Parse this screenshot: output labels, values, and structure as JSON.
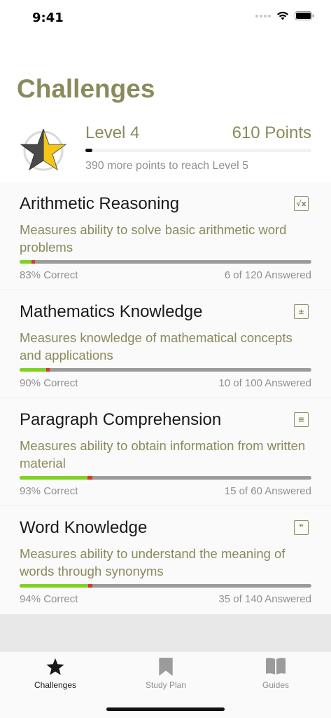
{
  "status": {
    "time": "9:41"
  },
  "page": {
    "title": "Challenges"
  },
  "level": {
    "label": "Level 4",
    "points": "610 Points",
    "remaining": "390 more points to reach Level 5",
    "progress_fraction": 0.03
  },
  "challenges": [
    {
      "title": "Arithmetic Reasoning",
      "icon": "square-root-icon",
      "icon_glyph": "√x",
      "description": "Measures ability to solve basic arithmetic word problems",
      "correct_text": "83% Correct",
      "answered_text": "6 of 120 Answered",
      "answered_fraction": 0.05,
      "correct_ratio": 0.83
    },
    {
      "title": "Mathematics Knowledge",
      "icon": "calculator-icon",
      "icon_glyph": "±",
      "description": "Measures knowledge of mathematical concepts and applications",
      "correct_text": "90% Correct",
      "answered_text": "10 of 100 Answered",
      "answered_fraction": 0.1,
      "correct_ratio": 0.9
    },
    {
      "title": "Paragraph Comprehension",
      "icon": "paragraph-icon",
      "icon_glyph": "≡",
      "description": "Measures ability to obtain information from written material",
      "correct_text": "93% Correct",
      "answered_text": "15 of 60 Answered",
      "answered_fraction": 0.25,
      "correct_ratio": 0.93
    },
    {
      "title": "Word Knowledge",
      "icon": "quote-icon",
      "icon_glyph": "❞",
      "description": "Measures ability to understand the meaning of words through synonyms",
      "correct_text": "94% Correct",
      "answered_text": "35 of 140 Answered",
      "answered_fraction": 0.25,
      "correct_ratio": 0.94
    }
  ],
  "tabs": [
    {
      "label": "Challenges",
      "icon": "star-icon",
      "active": true
    },
    {
      "label": "Study Plan",
      "icon": "bookmark-icon",
      "active": false
    },
    {
      "label": "Guides",
      "icon": "book-icon",
      "active": false
    }
  ],
  "colors": {
    "accent": "#8a8a5c",
    "correct": "#7ed321",
    "wrong": "#e0332b",
    "remaining": "#9b9b9b"
  }
}
